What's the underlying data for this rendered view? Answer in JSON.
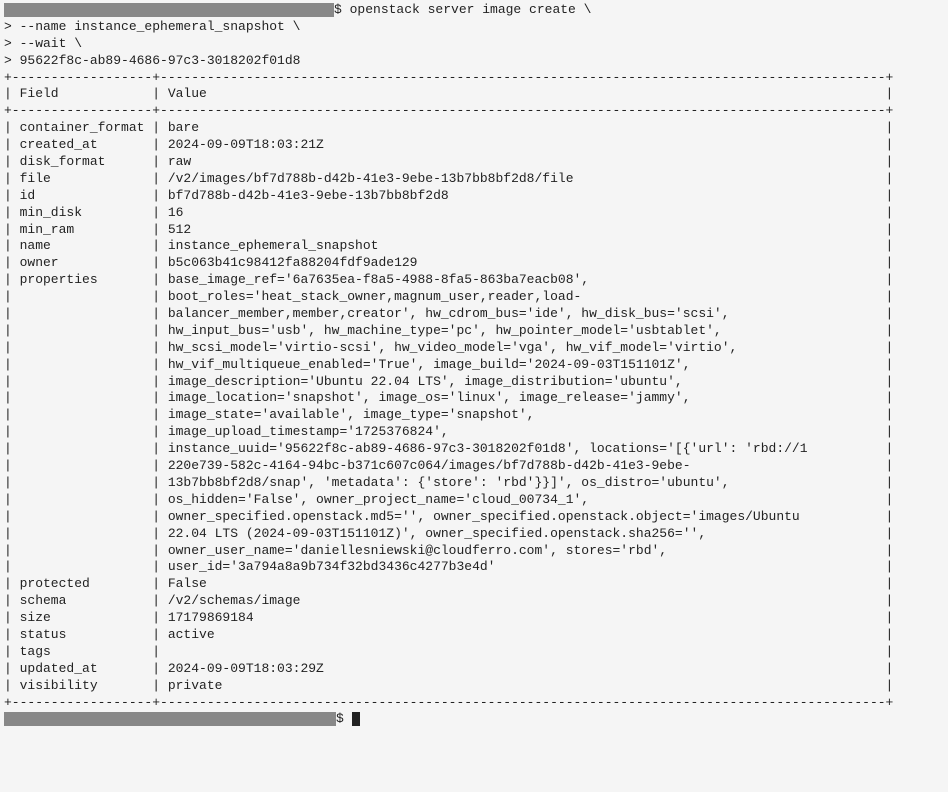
{
  "command": {
    "prompt_suffix": "$ ",
    "cmd_line": "openstack server image create \\",
    "cont1": "> --name instance_ephemeral_snapshot \\",
    "cont2": "> --wait \\",
    "cont3": "> 95622f8c-ab89-4686-97c3-3018202f01d8"
  },
  "table": {
    "header_field": "Field",
    "header_value": "Value",
    "rows": [
      {
        "field": "container_format",
        "value": "bare"
      },
      {
        "field": "created_at",
        "value": "2024-09-09T18:03:21Z"
      },
      {
        "field": "disk_format",
        "value": "raw"
      },
      {
        "field": "file",
        "value": "/v2/images/bf7d788b-d42b-41e3-9ebe-13b7bb8bf2d8/file"
      },
      {
        "field": "id",
        "value": "bf7d788b-d42b-41e3-9ebe-13b7bb8bf2d8"
      },
      {
        "field": "min_disk",
        "value": "16"
      },
      {
        "field": "min_ram",
        "value": "512"
      },
      {
        "field": "name",
        "value": "instance_ephemeral_snapshot"
      },
      {
        "field": "owner",
        "value": "b5c063b41c98412fa88204fdf9ade129"
      },
      {
        "field": "properties",
        "value": "base_image_ref='6a7635ea-f8a5-4988-8fa5-863ba7eacb08',"
      },
      {
        "field": "",
        "value": "boot_roles='heat_stack_owner,magnum_user,reader,load-"
      },
      {
        "field": "",
        "value": "balancer_member,member,creator', hw_cdrom_bus='ide', hw_disk_bus='scsi',"
      },
      {
        "field": "",
        "value": "hw_input_bus='usb', hw_machine_type='pc', hw_pointer_model='usbtablet',"
      },
      {
        "field": "",
        "value": "hw_scsi_model='virtio-scsi', hw_video_model='vga', hw_vif_model='virtio',"
      },
      {
        "field": "",
        "value": "hw_vif_multiqueue_enabled='True', image_build='2024-09-03T151101Z',"
      },
      {
        "field": "",
        "value": "image_description='Ubuntu 22.04 LTS', image_distribution='ubuntu',"
      },
      {
        "field": "",
        "value": "image_location='snapshot', image_os='linux', image_release='jammy',"
      },
      {
        "field": "",
        "value": "image_state='available', image_type='snapshot',"
      },
      {
        "field": "",
        "value": "image_upload_timestamp='1725376824',"
      },
      {
        "field": "",
        "value": "instance_uuid='95622f8c-ab89-4686-97c3-3018202f01d8', locations='[{'url': 'rbd://1"
      },
      {
        "field": "",
        "value": "220e739-582c-4164-94bc-b371c607c064/images/bf7d788b-d42b-41e3-9ebe-"
      },
      {
        "field": "",
        "value": "13b7bb8bf2d8/snap', 'metadata': {'store': 'rbd'}}]', os_distro='ubuntu',"
      },
      {
        "field": "",
        "value": "os_hidden='False', owner_project_name='cloud_00734_1',"
      },
      {
        "field": "",
        "value": "owner_specified.openstack.md5='', owner_specified.openstack.object='images/Ubuntu"
      },
      {
        "field": "",
        "value": "22.04 LTS (2024-09-03T151101Z)', owner_specified.openstack.sha256='',"
      },
      {
        "field": "",
        "value": "owner_user_name='daniellesniewski@cloudferro.com', stores='rbd',"
      },
      {
        "field": "",
        "value": "user_id='3a794a8a9b734f32bd3436c4277b3e4d'"
      },
      {
        "field": "protected",
        "value": "False"
      },
      {
        "field": "schema",
        "value": "/v2/schemas/image"
      },
      {
        "field": "size",
        "value": "17179869184"
      },
      {
        "field": "status",
        "value": "active"
      },
      {
        "field": "tags",
        "value": ""
      },
      {
        "field": "updated_at",
        "value": "2024-09-09T18:03:29Z"
      },
      {
        "field": "visibility",
        "value": "private"
      }
    ]
  },
  "final_prompt": "$ "
}
